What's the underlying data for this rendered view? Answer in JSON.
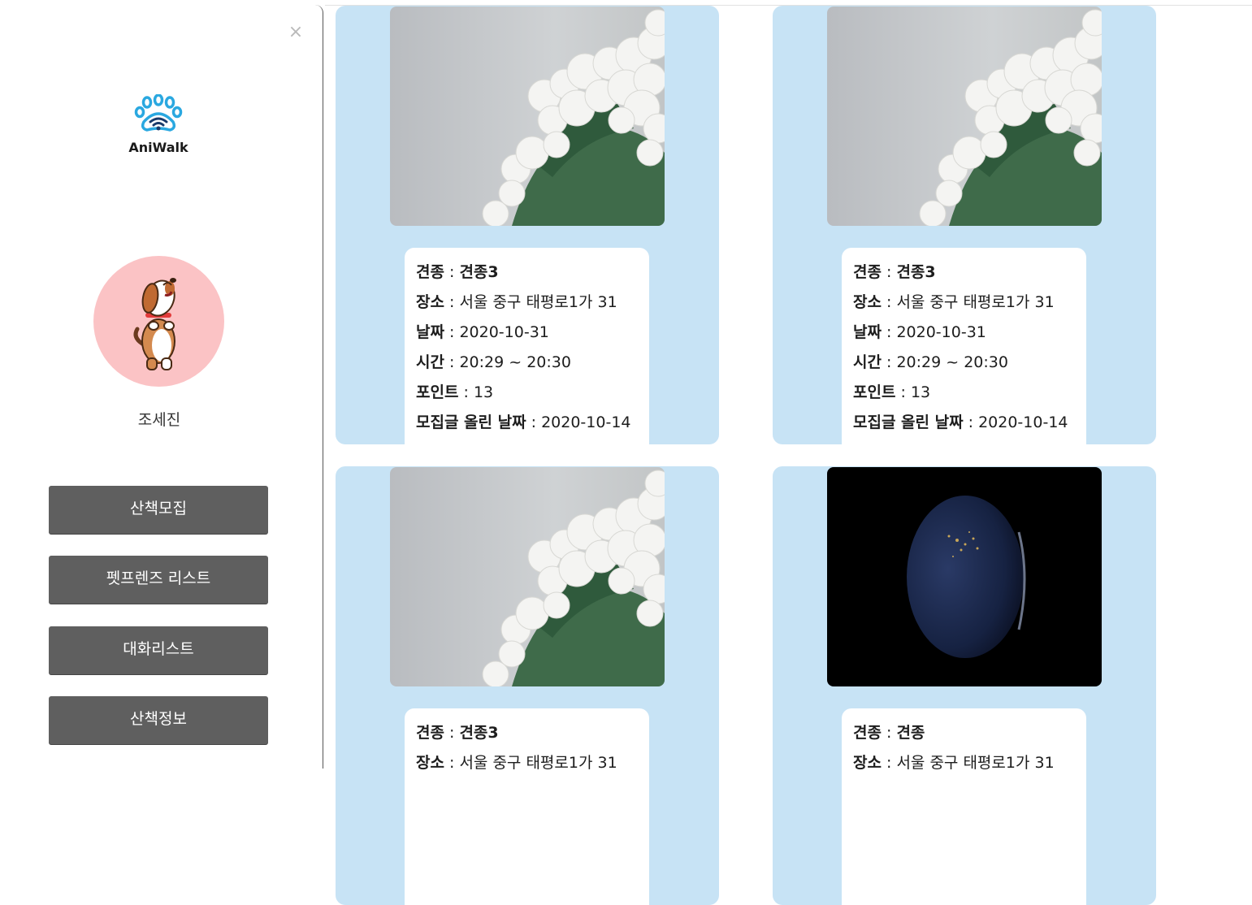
{
  "sidebar": {
    "close_label": "×",
    "logo_text": "AniWalk",
    "username": "조세진",
    "menu": [
      {
        "label": "산책모집"
      },
      {
        "label": "펫프렌즈 리스트"
      },
      {
        "label": "대화리스트"
      },
      {
        "label": "산책정보"
      }
    ]
  },
  "cards": [
    {
      "photo": "white-flowers-photo",
      "breed_key": "견종",
      "breed": "견종3",
      "place_key": "장소",
      "place": "서울 중구 태평로1가 31",
      "date_key": "날짜",
      "date": "2020-10-31",
      "time_key": "시간",
      "time": "20:29 ~ 20:30",
      "points_key": "포인트",
      "points": "13",
      "posted_key": "모집글 올린 날짜",
      "posted": "2020-10-14"
    },
    {
      "photo": "white-flowers-photo",
      "breed_key": "견종",
      "breed": "견종3",
      "place_key": "장소",
      "place": "서울 중구 태평로1가 31",
      "date_key": "날짜",
      "date": "2020-10-31",
      "time_key": "시간",
      "time": "20:29 ~ 20:30",
      "points_key": "포인트",
      "points": "13",
      "posted_key": "모집글 올린 날짜",
      "posted": "2020-10-14"
    },
    {
      "photo": "white-flowers-photo",
      "breed_key": "견종",
      "breed": "견종3",
      "place_key": "장소",
      "place": "서울 중구 태평로1가 31"
    },
    {
      "photo": "earth-at-night-photo",
      "breed_key": "견종",
      "breed": "견종",
      "place_key": "장소",
      "place": "서울 중구 태평로1가 31"
    }
  ],
  "colors": {
    "card_bg": "#c7e3f5",
    "button_bg": "#5f5f5f",
    "avatar_bg": "#fbc3c5",
    "logo_blue": "#2aa8e0"
  }
}
